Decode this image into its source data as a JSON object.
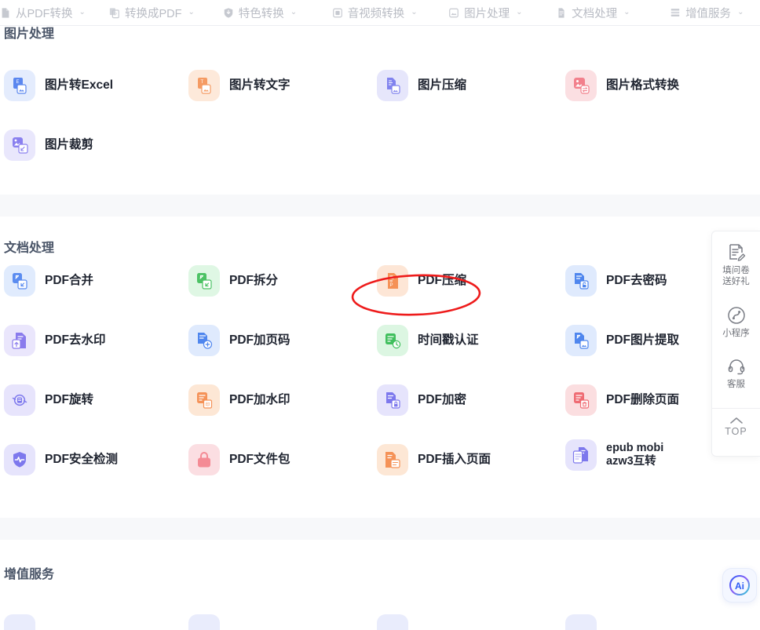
{
  "nav": {
    "items": [
      {
        "label": "从PDF转换",
        "icon": "file-pdf-icon",
        "caret": "⌄"
      },
      {
        "label": "转换成PDF",
        "icon": "file-convert-icon",
        "caret": "⌄"
      },
      {
        "label": "特色转换",
        "icon": "shield-star-icon",
        "caret": "⌄"
      },
      {
        "label": "音视频转换",
        "icon": "media-icon",
        "caret": "⌄"
      },
      {
        "label": "图片处理",
        "icon": "image-icon",
        "caret": "⌄"
      },
      {
        "label": "文档处理",
        "icon": "document-icon",
        "caret": "⌄"
      },
      {
        "label": "增值服务",
        "icon": "list-icon",
        "caret": "⌄"
      }
    ]
  },
  "sections": [
    {
      "id": "image-processing",
      "title": "图片处理",
      "tools": [
        {
          "label": "图片转Excel",
          "icon": "image-to-excel-icon",
          "bg": "#e4ecfd",
          "fg": "#5b87ef"
        },
        {
          "label": "图片转文字",
          "icon": "image-to-text-icon",
          "bg": "#fde9da",
          "fg": "#f59b63"
        },
        {
          "label": "图片压缩",
          "icon": "image-compress-icon",
          "bg": "#e6e6fb",
          "fg": "#8183ee"
        },
        {
          "label": "图片格式转换",
          "icon": "image-format-icon",
          "bg": "#fbdfe2",
          "fg": "#f2808c"
        },
        {
          "label": "图片裁剪",
          "icon": "image-crop-icon",
          "bg": "#e9e7fc",
          "fg": "#8a80ef"
        }
      ]
    },
    {
      "id": "document-processing",
      "title": "文档处理",
      "tools": [
        {
          "label": "PDF合并",
          "icon": "pdf-merge-icon",
          "bg": "#e0ebfd",
          "fg": "#5b8cf0"
        },
        {
          "label": "PDF拆分",
          "icon": "pdf-split-icon",
          "bg": "#dff7e4",
          "fg": "#4cc264"
        },
        {
          "label": "PDF压缩",
          "icon": "pdf-compress-icon",
          "bg": "#fde6d6",
          "fg": "#f59257"
        },
        {
          "label": "PDF去密码",
          "icon": "pdf-unlock-icon",
          "bg": "#dfeafd",
          "fg": "#4f86ee"
        },
        {
          "label": "PDF去水印",
          "icon": "pdf-remove-mark-icon",
          "bg": "#eae6fc",
          "fg": "#8a7bed"
        },
        {
          "label": "PDF加页码",
          "icon": "pdf-page-number-icon",
          "bg": "#dfeafd",
          "fg": "#4f86ee"
        },
        {
          "label": "时间戳认证",
          "icon": "timestamp-icon",
          "bg": "#dcf6e2",
          "fg": "#40bf5d"
        },
        {
          "label": "PDF图片提取",
          "icon": "pdf-extract-image-icon",
          "bg": "#dfeafd",
          "fg": "#4f86ee"
        },
        {
          "label": "PDF旋转",
          "icon": "pdf-rotate-icon",
          "bg": "#e7e4fc",
          "fg": "#7d78ed"
        },
        {
          "label": "PDF加水印",
          "icon": "pdf-watermark-icon",
          "bg": "#fde7d5",
          "fg": "#f59257"
        },
        {
          "label": "PDF加密",
          "icon": "pdf-encrypt-icon",
          "bg": "#e6e4fc",
          "fg": "#7d78ed"
        },
        {
          "label": "PDF删除页面",
          "icon": "pdf-delete-page-icon",
          "bg": "#fbdee0",
          "fg": "#ef6b73"
        },
        {
          "label": "PDF安全检测",
          "icon": "pdf-security-scan-icon",
          "bg": "#e6e4fc",
          "fg": "#7d78ed"
        },
        {
          "label": "PDF文件包",
          "icon": "pdf-package-icon",
          "bg": "#fbdee2",
          "fg": "#f48b95"
        },
        {
          "label": "PDF插入页面",
          "icon": "pdf-insert-page-icon",
          "bg": "#fde7d5",
          "fg": "#f59257"
        },
        {
          "label": "epub mobi\nazw3互转",
          "icon": "ebook-convert-icon",
          "bg": "#e6e4fc",
          "fg": "#7d78ed"
        }
      ]
    },
    {
      "id": "value-added-services",
      "title": "增值服务",
      "tools": []
    }
  ],
  "side_widget": {
    "items": [
      {
        "label": "填问卷\n送好礼",
        "icon": "survey-icon"
      },
      {
        "label": "小程序",
        "icon": "miniprogram-icon"
      },
      {
        "label": "客服",
        "icon": "headset-icon"
      },
      {
        "label": "TOP",
        "icon": "back-to-top-icon"
      }
    ]
  },
  "annotation": {
    "shape": "ellipse",
    "color": "#ee1b1b",
    "target_label": "PDF压缩"
  },
  "ai_button": {
    "label": "Ai",
    "icon": "ai-assistant-icon"
  }
}
